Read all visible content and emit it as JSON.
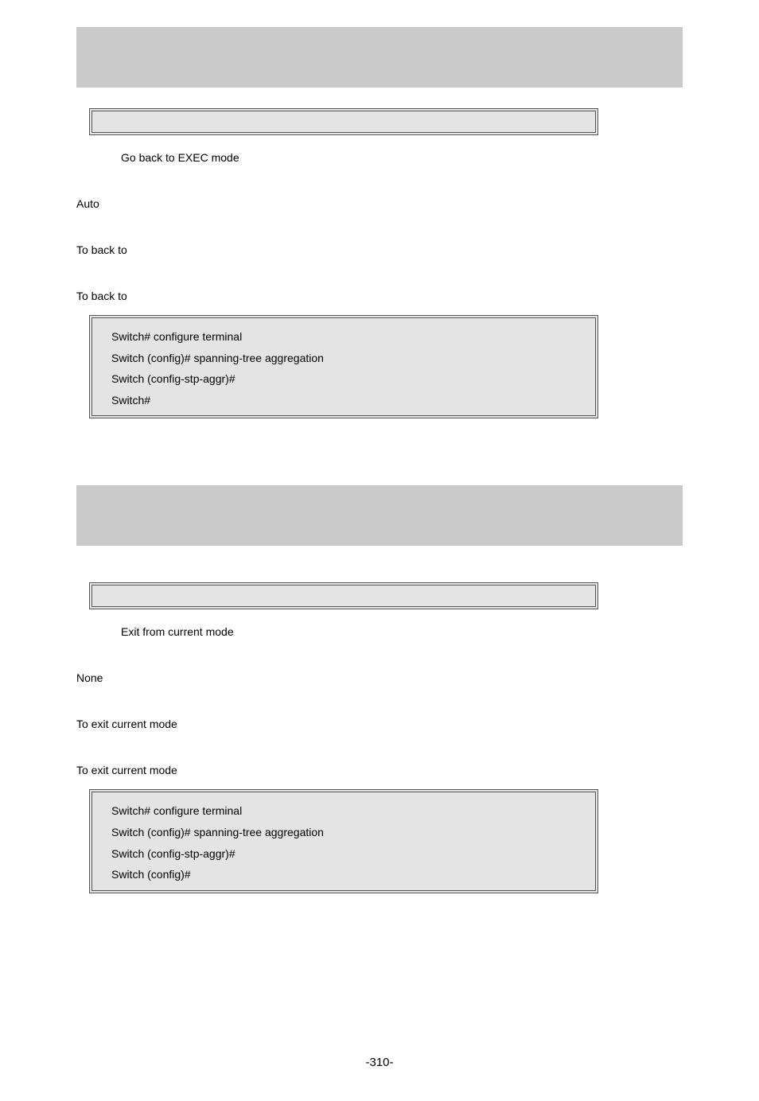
{
  "section1": {
    "desc": "Go back to EXEC mode",
    "p1": "Auto",
    "p2": "To back to",
    "p3": "To back to",
    "code": [
      "Switch# configure terminal",
      "Switch (config)# spanning-tree aggregation",
      "Switch (config-stp-aggr)#",
      "Switch#"
    ]
  },
  "section2": {
    "desc": "Exit from current mode",
    "p1": "None",
    "p2": "To exit current mode",
    "p3": "To exit current mode",
    "code": [
      "Switch# configure terminal",
      "Switch (config)# spanning-tree aggregation",
      "Switch (config-stp-aggr)#",
      "Switch (config)#"
    ]
  },
  "footer": "-310-"
}
